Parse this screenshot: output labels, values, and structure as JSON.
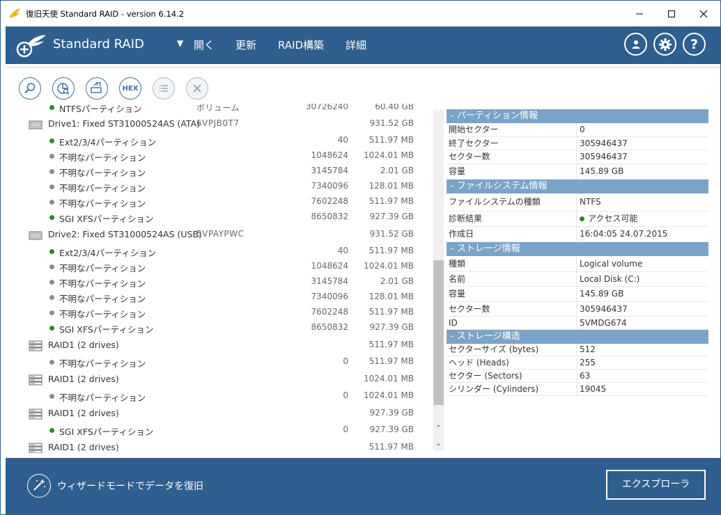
{
  "window": {
    "title": "復旧天使 Standard RAID - version 6.14.2"
  },
  "header": {
    "app_name": "Standard RAID",
    "menu": [
      "開く",
      "更新",
      "RAID構築",
      "詳細"
    ]
  },
  "tree": {
    "rows": [
      {
        "kind": "partition",
        "dot": "green",
        "name": "NTFSパーティション",
        "sector": "30726240",
        "size": "60.40 GB",
        "extra": "ボリューム"
      },
      {
        "kind": "drive",
        "name": "Drive1: Fixed ST31000524AS (ATA)",
        "serial": "6VPJB0T7",
        "size": "931.52 GB"
      },
      {
        "kind": "partition",
        "dot": "green",
        "name": "Ext2/3/4パーティション",
        "sector": "40",
        "size": "511.97 MB"
      },
      {
        "kind": "partition",
        "dot": "gray",
        "name": "不明なパーティション",
        "sector": "1048624",
        "size": "1024.01 MB"
      },
      {
        "kind": "partition",
        "dot": "gray",
        "name": "不明なパーティション",
        "sector": "3145784",
        "size": "2.01 GB"
      },
      {
        "kind": "partition",
        "dot": "gray",
        "name": "不明なパーティション",
        "sector": "7340096",
        "size": "128.01 MB"
      },
      {
        "kind": "partition",
        "dot": "gray",
        "name": "不明なパーティション",
        "sector": "7602248",
        "size": "511.97 MB"
      },
      {
        "kind": "partition",
        "dot": "green",
        "name": "SGI XFSパーティション",
        "sector": "8650832",
        "size": "927.39 GB"
      },
      {
        "kind": "drive",
        "name": "Drive2: Fixed ST31000524AS (USB)",
        "serial": "5VPAYPWC",
        "size": "931.52 GB"
      },
      {
        "kind": "partition",
        "dot": "green",
        "name": "Ext2/3/4パーティション",
        "sector": "40",
        "size": "511.97 MB"
      },
      {
        "kind": "partition",
        "dot": "gray",
        "name": "不明なパーティション",
        "sector": "1048624",
        "size": "1024.01 MB"
      },
      {
        "kind": "partition",
        "dot": "gray",
        "name": "不明なパーティション",
        "sector": "3145784",
        "size": "2.01 GB"
      },
      {
        "kind": "partition",
        "dot": "gray",
        "name": "不明なパーティション",
        "sector": "7340096",
        "size": "128.01 MB"
      },
      {
        "kind": "partition",
        "dot": "gray",
        "name": "不明なパーティション",
        "sector": "7602248",
        "size": "511.97 MB"
      },
      {
        "kind": "partition",
        "dot": "green",
        "name": "SGI XFSパーティション",
        "sector": "8650832",
        "size": "927.39 GB"
      },
      {
        "kind": "raid",
        "name": "RAID1 (2 drives)",
        "size": "511.97 MB"
      },
      {
        "kind": "partition",
        "dot": "gray",
        "name": "不明なパーティション",
        "sector": "0",
        "size": "511.97 MB"
      },
      {
        "kind": "raid",
        "name": "RAID1 (2 drives)",
        "size": "1024.01 MB"
      },
      {
        "kind": "partition",
        "dot": "gray",
        "name": "不明なパーティション",
        "sector": "0",
        "size": "1024.01 MB"
      },
      {
        "kind": "raid",
        "name": "RAID1 (2 drives)",
        "size": "927.39 GB"
      },
      {
        "kind": "partition",
        "dot": "green",
        "name": "SGI XFSパーティション",
        "sector": "0",
        "size": "927.39 GB"
      },
      {
        "kind": "raid",
        "name": "RAID1 (2 drives)",
        "size": "511.97 MB"
      }
    ]
  },
  "properties": {
    "sections": [
      {
        "title": "-  パーティション情報",
        "rows": [
          {
            "k": "開始セクター",
            "v": "0"
          },
          {
            "k": "終了セクター",
            "v": "305946437"
          },
          {
            "k": "セクター数",
            "v": "305946437"
          },
          {
            "k": "容量",
            "v": "145.89 GB"
          }
        ]
      },
      {
        "title": "-  ファイルシステム情報",
        "rows": [
          {
            "k": "ファイルシステムの種類",
            "v": "NTFS"
          },
          {
            "k": "診断結果",
            "v": "アクセス可能",
            "dot": "green"
          },
          {
            "k": "作成日",
            "v": "16:04:05 24.07.2015"
          }
        ]
      },
      {
        "title": "-  ストレージ情報",
        "rows": [
          {
            "k": "種類",
            "v": "Logical volume"
          },
          {
            "k": "名前",
            "v": "Local Disk (C:)"
          },
          {
            "k": "容量",
            "v": "145.89 GB"
          },
          {
            "k": "セクター数",
            "v": "305946437"
          },
          {
            "k": "ID",
            "v": "5VMDG674"
          }
        ]
      },
      {
        "title": "-  ストレージ構造",
        "rows": [
          {
            "k": "セクターサイズ (bytes)",
            "v": "512"
          },
          {
            "k": "ヘッド (Heads)",
            "v": "255"
          },
          {
            "k": "セクター (Sectors)",
            "v": "63"
          },
          {
            "k": "シリンダー (Cylinders)",
            "v": "19045"
          }
        ]
      }
    ]
  },
  "footer": {
    "wizard_label": "ウィザードモードでデータを復旧",
    "explorer_label": "エクスプローラ"
  },
  "colors": {
    "header": "#2e5f8f",
    "section": "#7ba3c8",
    "green_dot": "#2a8a2a",
    "gray_dot": "#8c8c8c"
  },
  "icons": [
    "angel-wing-icon",
    "minimize-icon",
    "maximize-icon",
    "close-icon",
    "user-icon",
    "gear-icon",
    "help-icon",
    "search-icon",
    "scan-icon",
    "image-icon",
    "hex-icon",
    "list-icon",
    "cancel-icon",
    "hdd-icon",
    "raid-icon",
    "wizard-wand-icon"
  ]
}
